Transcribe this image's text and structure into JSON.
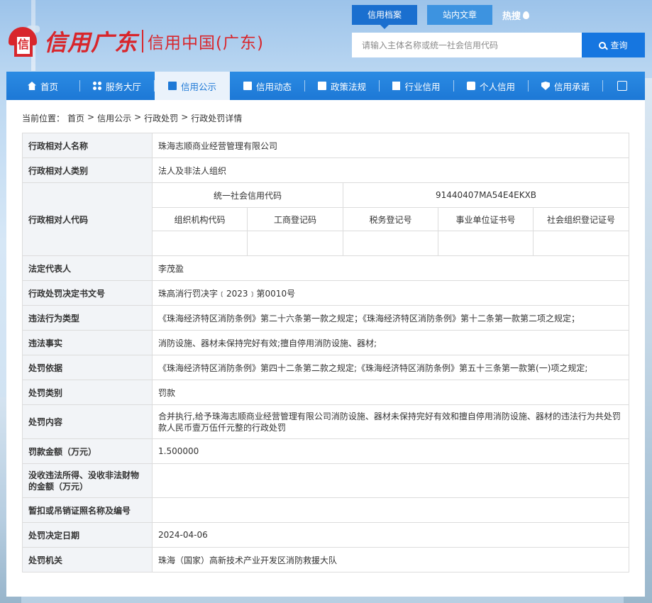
{
  "header": {
    "logo_mark_text": "信",
    "logo_name": "信用广东",
    "logo_subtitle": "信用中国(广东)",
    "top_tabs": [
      "信用档案",
      "站内文章"
    ],
    "hot_search_label": "热搜",
    "search": {
      "placeholder": "请输入主体名称或统一社会信用代码",
      "button_label": "查询"
    }
  },
  "nav": {
    "items": [
      {
        "label": "首页",
        "icon": "home-icon"
      },
      {
        "label": "服务大厅",
        "icon": "grid-icon"
      },
      {
        "label": "信用公示",
        "icon": "publicity-icon",
        "active": true
      },
      {
        "label": "信用动态",
        "icon": "news-icon"
      },
      {
        "label": "政策法规",
        "icon": "policy-icon"
      },
      {
        "label": "行业信用",
        "icon": "industry-icon"
      },
      {
        "label": "个人信用",
        "icon": "person-icon"
      },
      {
        "label": "信用承诺",
        "icon": "shield-icon"
      }
    ],
    "exit_icon": "exit-icon"
  },
  "breadcrumb": {
    "prefix": "当前位置：",
    "items": [
      "首页",
      "信用公示",
      "行政处罚",
      "行政处罚详情"
    ],
    "separator": ">"
  },
  "detail": {
    "name_label": "行政相对人名称",
    "name_value": "珠海志顺商业经营管理有限公司",
    "category_label": "行政相对人类别",
    "category_value": "法人及非法人组织",
    "code_label": "行政相对人代码",
    "uscc_label": "统一社会信用代码",
    "uscc_value": "91440407MA54E4EKXB",
    "sub_codes": [
      "组织机构代码",
      "工商登记码",
      "税务登记号",
      "事业单位证书号",
      "社会组织登记证号"
    ],
    "legal_rep_label": "法定代表人",
    "legal_rep_value": "李茂盈",
    "doc_no_label": "行政处罚决定书文号",
    "doc_no_value": "珠高消行罚决字﹝2023﹞第0010号",
    "violation_type_label": "违法行为类型",
    "violation_type_value": "《珠海经济特区消防条例》第二十六条第一款之规定；《珠海经济特区消防条例》第十二条第一款第二项之规定；",
    "facts_label": "违法事实",
    "facts_value": "消防设施、器材未保持完好有效;擅自停用消防设施、器材;",
    "basis_label": "处罚依据",
    "basis_value": "《珠海经济特区消防条例》第四十二条第二款之规定;《珠海经济特区消防条例》第五十三条第一款第(一)项之规定;",
    "penalty_type_label": "处罚类别",
    "penalty_type_value": "罚款",
    "content_label": "处罚内容",
    "content_value": "合并执行,给予珠海志顺商业经营管理有限公司消防设施、器材未保持完好有效和擅自停用消防设施、器材的违法行为共处罚款人民币壹万伍仟元整的行政处罚",
    "fine_label": "罚款金额（万元）",
    "fine_value": "1.500000",
    "confiscation_label": "没收违法所得、没收非法财物的金额（万元）",
    "confiscation_value": "",
    "license_label": "暂扣或吊销证照名称及编号",
    "license_value": "",
    "date_label": "处罚决定日期",
    "date_value": "2024-04-06",
    "authority_label": "处罚机关",
    "authority_value": "珠海（国家）高新技术产业开发区消防救援大队"
  },
  "colors": {
    "brand_red": "#d8262c",
    "nav_blue": "#1d78d6",
    "search_button": "#1676e0"
  }
}
